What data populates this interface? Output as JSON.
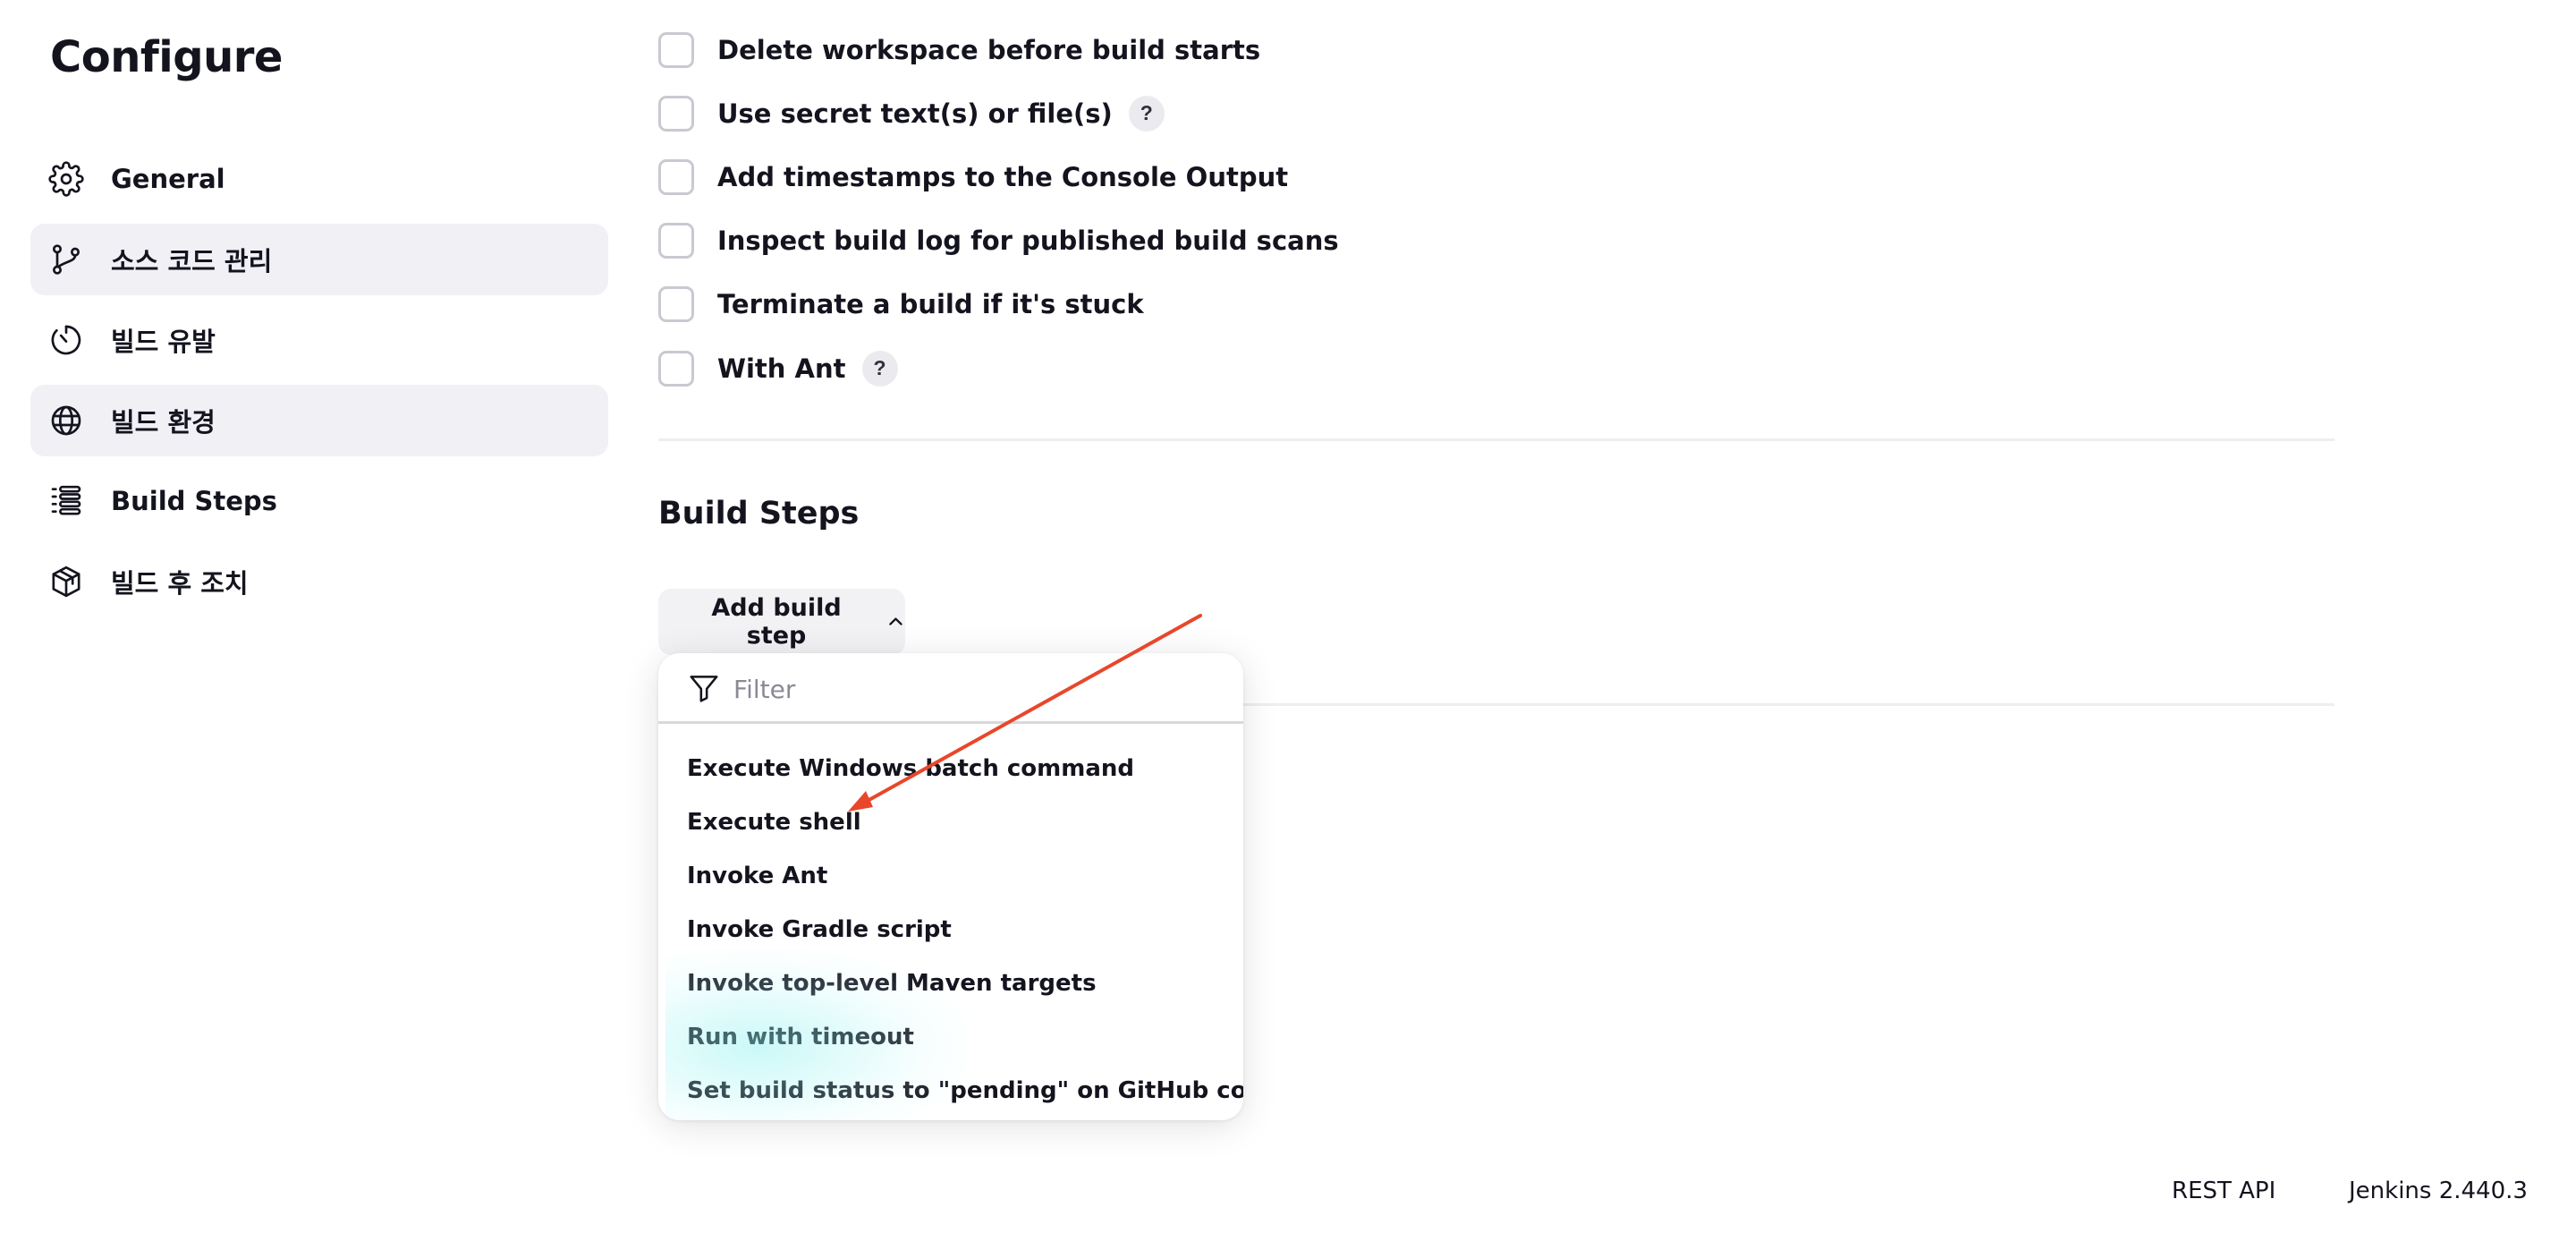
{
  "page_title": "Configure",
  "sidebar": {
    "items": [
      {
        "label": "General",
        "icon": "gear-icon"
      },
      {
        "label": "소스 코드 관리",
        "icon": "git-branch-icon",
        "active": true
      },
      {
        "label": "빌드 유발",
        "icon": "timer-icon"
      },
      {
        "label": "빌드 환경",
        "icon": "globe-icon",
        "active": true
      },
      {
        "label": "Build Steps",
        "icon": "list-icon"
      },
      {
        "label": "빌드 후 조치",
        "icon": "package-icon"
      }
    ]
  },
  "build_environment": {
    "options": [
      {
        "label": "Delete workspace before build starts",
        "checked": false,
        "help": false
      },
      {
        "label": "Use secret text(s) or file(s)",
        "checked": false,
        "help": true
      },
      {
        "label": "Add timestamps to the Console Output",
        "checked": false,
        "help": false
      },
      {
        "label": "Inspect build log for published build scans",
        "checked": false,
        "help": false
      },
      {
        "label": "Terminate a build if it's stuck",
        "checked": false,
        "help": false
      },
      {
        "label": "With Ant",
        "checked": false,
        "help": true
      }
    ],
    "help_glyph": "?"
  },
  "build_steps": {
    "title": "Build Steps",
    "add_button_label": "Add build step",
    "dropdown": {
      "filter_placeholder": "Filter",
      "items": [
        "Execute Windows batch command",
        "Execute shell",
        "Invoke Ant",
        "Invoke Gradle script",
        "Invoke top-level Maven targets",
        "Run with timeout",
        "Set build status to \"pending\" on GitHub commit"
      ]
    }
  },
  "footer": {
    "rest_api": "REST API",
    "version": "Jenkins 2.440.3"
  },
  "colors": {
    "accent_arrow": "#e8472b",
    "active_bg": "#f0f0f5",
    "text": "#14141f"
  }
}
